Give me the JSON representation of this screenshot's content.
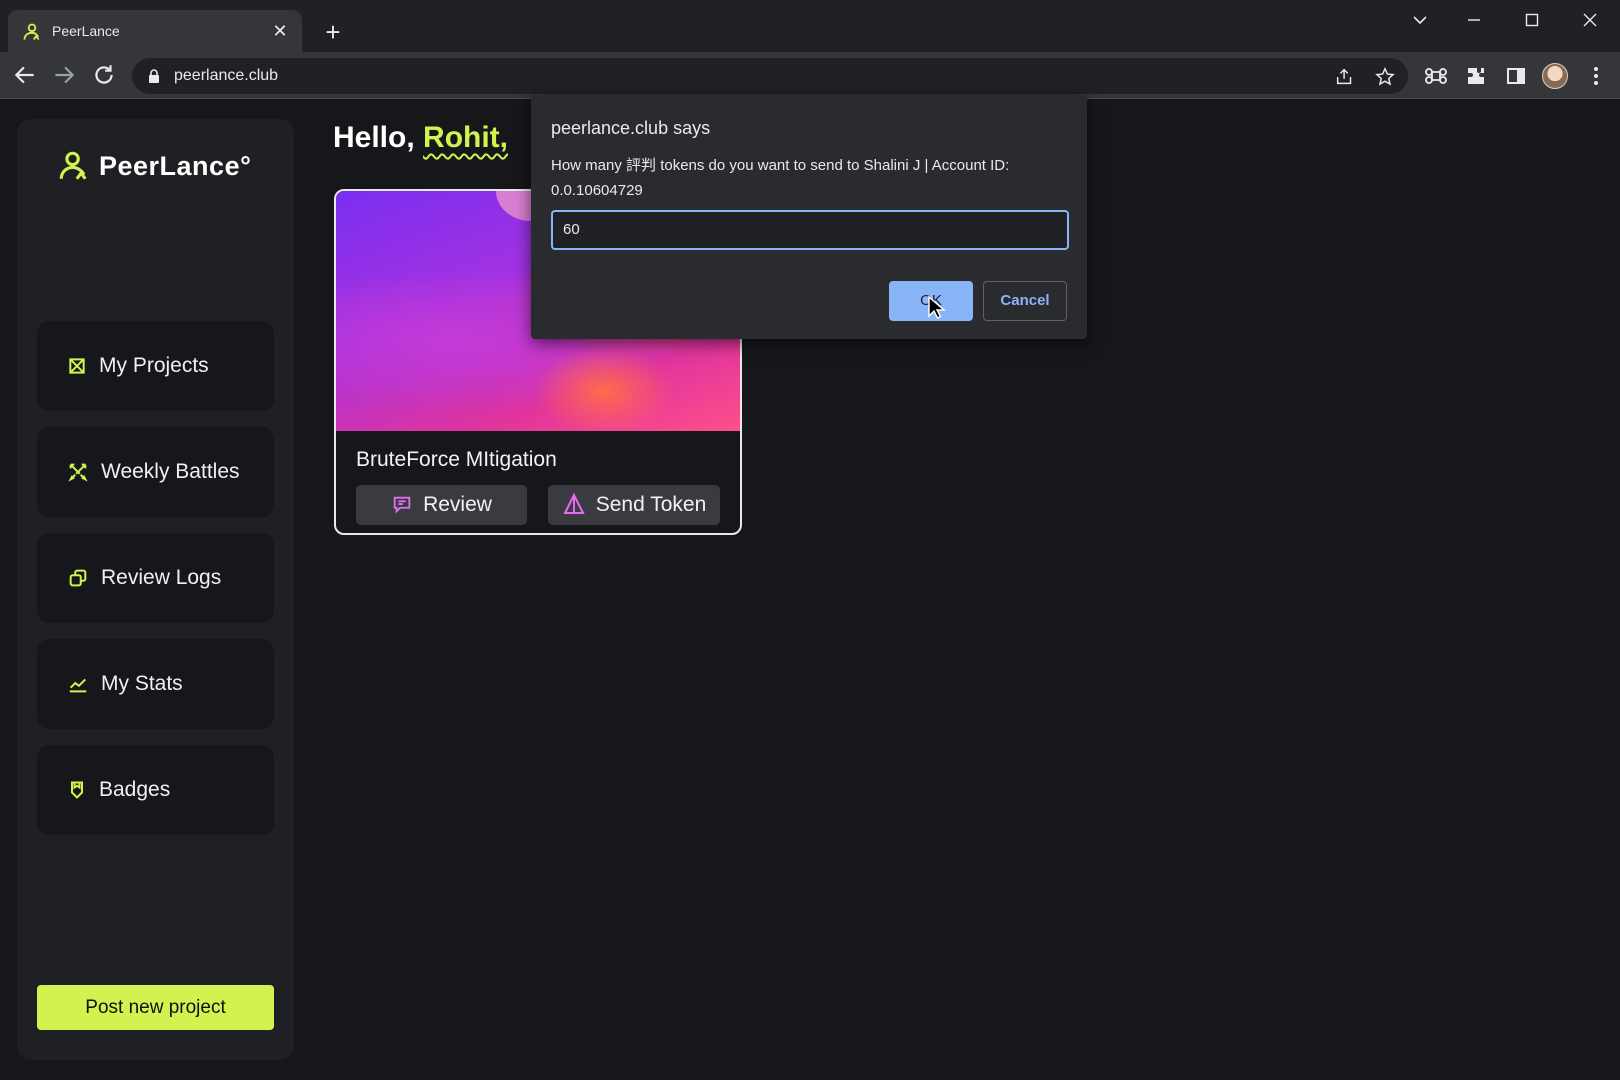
{
  "browser": {
    "tab_title": "PeerLance",
    "url": "peerlance.club"
  },
  "app": {
    "logo_text": "PeerLance°",
    "accent_color": "#d3f24f",
    "greeting_prefix": "Hello,",
    "user_name": "Rohit,",
    "nav": [
      {
        "label": "My Projects",
        "icon": "projects-icon"
      },
      {
        "label": "Weekly Battles",
        "icon": "battles-icon"
      },
      {
        "label": "Review Logs",
        "icon": "review-logs-icon"
      },
      {
        "label": "My Stats",
        "icon": "stats-chart-icon"
      },
      {
        "label": "Badges",
        "icon": "badge-icon"
      }
    ],
    "post_button": "Post new project",
    "project_card": {
      "title": "BruteForce MItigation",
      "review_label": "Review",
      "send_token_label": "Send Token"
    }
  },
  "dialog": {
    "title": "peerlance.club says",
    "message": "How many 評判 tokens do you want to send to Shalini J | Account ID: 0.0.10604729",
    "input_value": "60",
    "ok_label": "OK",
    "cancel_label": "Cancel"
  }
}
